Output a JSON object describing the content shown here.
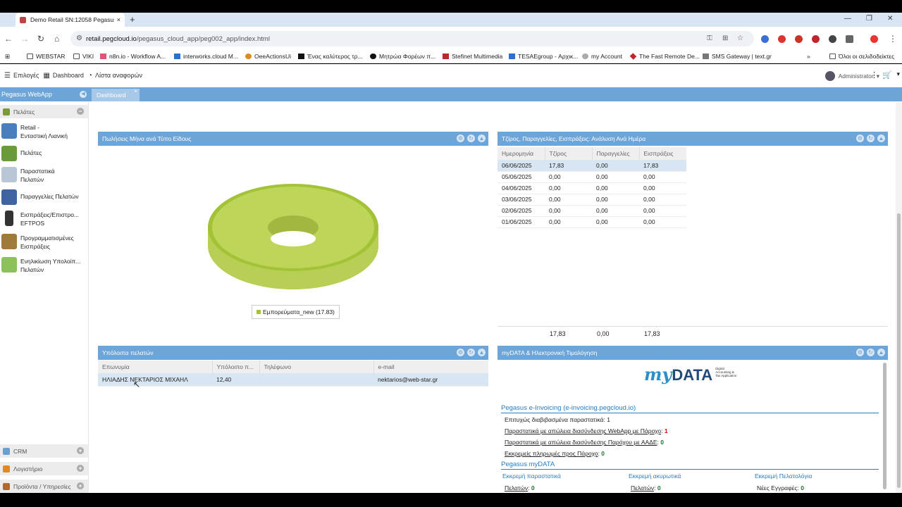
{
  "browser": {
    "tab_title": "Demo Retail SN:12058 Pegasus",
    "tab_close": "×",
    "new_tab": "+",
    "url_host": "retail.pegcloud.io",
    "url_path": "/pegasus_cloud_app/peg002_app/index.html",
    "bookmarks": [
      {
        "label": "WEBSTAR",
        "color": "#555"
      },
      {
        "label": "VIKI",
        "color": "#555"
      },
      {
        "label": "n8n.io - Workflow A...",
        "color": "#e4527a"
      },
      {
        "label": "interworks.cloud M...",
        "color": "#2a6fd1"
      },
      {
        "label": "OeeActionsUi",
        "color": "#e08a1e"
      },
      {
        "label": "Ένας καλύτερος τρ...",
        "color": "#111"
      },
      {
        "label": "Μητρώα Φορέων π...",
        "color": "#111"
      },
      {
        "label": "Stefinet Multimedia",
        "color": "#c0242c"
      },
      {
        "label": "TESAEgroup - Αρχικ...",
        "color": "#2a6fd1"
      },
      {
        "label": "my Account",
        "color": "#888"
      },
      {
        "label": "The Fast Remote De...",
        "color": "#c0242c"
      },
      {
        "label": "SMS Gateway | text.gr",
        "color": "#555"
      }
    ],
    "bookmarks_more": "»",
    "all_bookmarks": "Όλοι οι σελιδοδείκτες"
  },
  "appbar": {
    "options": "Επιλογές",
    "dashboard": "Dashboard",
    "reports": "Λίστα αναφορών",
    "user": "Administrator"
  },
  "app": {
    "brand": "Pegasus WebApp",
    "active_tab": "Dashboard"
  },
  "sidebar": {
    "section_customers": "Πελάτες",
    "items": [
      {
        "line1": "Retail -",
        "line2": "Ενταστική Λιανική"
      },
      {
        "line1": "Πελάτες",
        "line2": ""
      },
      {
        "line1": "Παραστατικά",
        "line2": "Πελατών"
      },
      {
        "line1": "Παραγγελίες Πελατών",
        "line2": ""
      },
      {
        "line1": "Εισπράξεις/Επιστρο...",
        "line2": "EFTPOS"
      },
      {
        "line1": "Προγραμματισμένες",
        "line2": "Εισπράξεις"
      },
      {
        "line1": "Ενηλικίωση Υπολοίπ...",
        "line2": "Πελατών"
      }
    ],
    "section_crm": "CRM",
    "section_accounting": "Λογιστήριο",
    "section_products": "Προϊόντα / Υπηρεσίες"
  },
  "panel_sales": {
    "title": "Πωλήσεις Μήνα ανά Τύπο Είδους",
    "legend": "Εμπορεύματα_new (17.83)"
  },
  "chart_data": {
    "type": "pie",
    "categories": [
      "Εμπορεύματα_new"
    ],
    "values": [
      17.83
    ],
    "title": "Πωλήσεις Μήνα ανά Τύπο Είδους",
    "colors": [
      "#a3c236"
    ]
  },
  "panel_daily": {
    "title": "Τζίρος, Παραγγελίες, Εισπράξεις: Ανάλυση Ανά Ημέρα",
    "headers": [
      "Ημερομηνία",
      "Τζίρος",
      "Παραγγελίες",
      "Εισπράξεις"
    ],
    "rows": [
      [
        "06/06/2025",
        "17,83",
        "0,00",
        "17,83"
      ],
      [
        "05/06/2025",
        "0,00",
        "0,00",
        "0,00"
      ],
      [
        "04/06/2025",
        "0,00",
        "0,00",
        "0,00"
      ],
      [
        "03/06/2025",
        "0,00",
        "0,00",
        "0,00"
      ],
      [
        "02/06/2025",
        "0,00",
        "0,00",
        "0,00"
      ],
      [
        "01/06/2025",
        "0,00",
        "0,00",
        "0,00"
      ]
    ],
    "totals": [
      "",
      "17,83",
      "0,00",
      "17,83"
    ]
  },
  "panel_balances": {
    "title": "Υπόλοιπα πελατών",
    "headers": [
      "Επωνυμία",
      "Υπόλοιπο π...",
      "Τηλέφωνο",
      "e-mail"
    ],
    "rows": [
      [
        "ΗΛΙΑΔΗΣ ΝΕΚΤΑΡΙΟΣ ΜΙΧΑΗΛ",
        "12,40",
        "",
        "nektarios@web-star.gr"
      ]
    ]
  },
  "panel_mydata": {
    "title": "myDATA & Ηλεκτρονική Τιμολόγηση",
    "logo_my": "my",
    "logo_data": "DATA",
    "logo_tag": "Digital Accounting & Tax Application",
    "einvoicing_title": "Pegasus e-Invoicing (e-invoicing.pegcloud.io)",
    "line1_label": "Επιτυχώς διαβιβασμένα παραστατικά:",
    "line1_value": "1",
    "line2_label": "Παραστατικά με απώλεια διασύνδεσης WebApp με Πάροχο",
    "line2_value": "1",
    "line3_label": "Παραστατικά με απώλεια διασύνδεσης Παρόχου με ΑΑΔΕ",
    "line3_value": "0",
    "line4_label": "Εκκρεμείς πληρωμές προς Πάροχο",
    "line4_value": "0",
    "mydata_title": "Pegasus myDATA",
    "col1_title": "Εκκρεμή παραστατικά",
    "col2_title": "Εκκρεμή ακυρωτικά",
    "col3_title": "Εκκρεμή Πελατολόγια",
    "col1_line_label": "Πελατών",
    "col1_line_value": "0",
    "col2_line_label": "Πελατών",
    "col2_line_value": "0",
    "col3_line_label": "Νέες Εγγραφές:",
    "col3_line_value": "0"
  }
}
